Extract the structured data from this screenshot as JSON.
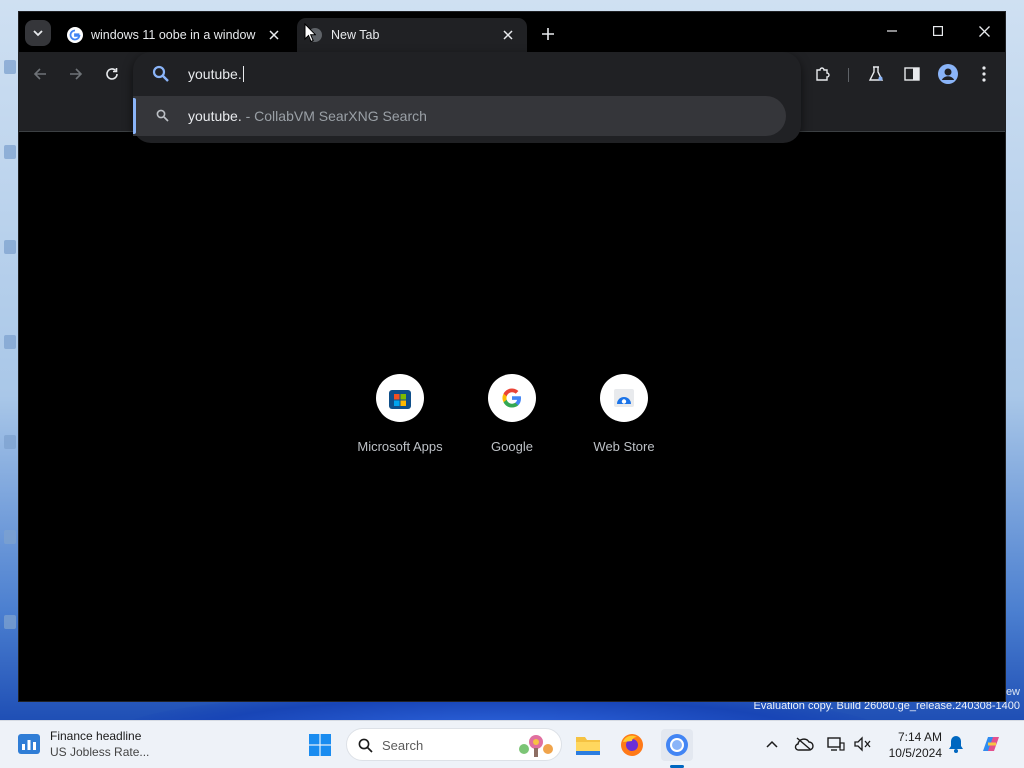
{
  "browser": {
    "tabs": [
      {
        "title": "windows 11 oobe in a window",
        "icon": "google-g-icon",
        "active": false
      },
      {
        "title": "New Tab",
        "icon": "globe-icon",
        "active": true
      }
    ]
  },
  "omnibox": {
    "value": "youtube.",
    "suggestion": {
      "main": "youtube.",
      "description": " - CollabVM SearXNG Search"
    }
  },
  "shortcuts": [
    {
      "label": "Microsoft Apps",
      "icon": "microsoft-store-icon"
    },
    {
      "label": "Google",
      "icon": "google-g-icon"
    },
    {
      "label": "Web Store",
      "icon": "web-store-icon"
    }
  ],
  "watermark": {
    "line1": "ew",
    "line2": "Evaluation copy. Build 26080.ge_release.240308-1400"
  },
  "taskbar": {
    "widget_title": "Finance headline",
    "widget_subtitle": "US Jobless Rate...",
    "search_label": "Search",
    "time": "7:14 AM",
    "date": "10/5/2024"
  },
  "colors": {
    "accent": "#8ab4f8",
    "toolbar": "#202124",
    "taskbar": "#eef2f8"
  }
}
